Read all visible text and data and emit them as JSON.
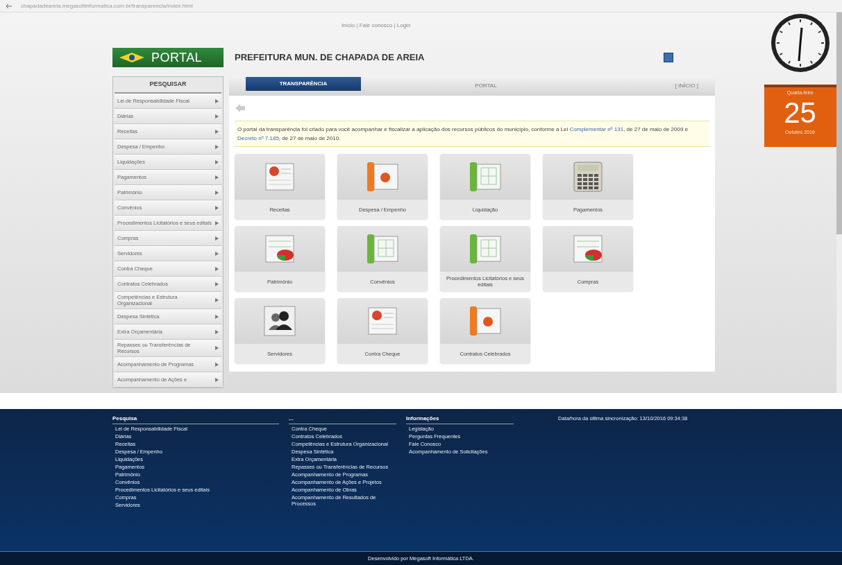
{
  "browser": {
    "url": "chapadadeareia.megasoftinformatica.com.br/transparencia/index.html"
  },
  "top_links": "Início | Fale conosco | Login",
  "header": {
    "logo_text": "PORTAL",
    "title": "PREFEITURA MUN. DE CHAPADA DE AREIA"
  },
  "sidebar": {
    "heading": "PESQUISAR",
    "items": [
      "Lei de Responsabilidade Fiscal",
      "Diárias",
      "Receitas",
      "Despesa / Empenho",
      "Liquidações",
      "Pagamentos",
      "Patrimônio",
      "Convênios",
      "Procedimentos Licitatórios e seus editais",
      "Compras",
      "Servidores",
      "Contra Cheque",
      "Contratos Celebrados",
      "Competências e Estrutura Organizacional",
      "Despesa Sintética",
      "Extra Orçamentária",
      "Repasses ou Transferências de Recursos",
      "Acompanhamento de Programas",
      "Acompanhamento de Ações e"
    ]
  },
  "tabs": [
    {
      "label": "TRANSPARÊNCIA",
      "selected": true
    },
    {
      "label": "PORTAL",
      "selected": false
    }
  ],
  "tab_bar_link": "[ INÍCIO ]",
  "notice": [
    {
      "kind": "text",
      "text": "O portal da transparência foi criado para você acompanhar e fiscalizar a aplicação dos recursos públicos do município, conforme a Lei "
    },
    {
      "kind": "link",
      "text": "Complementar nº 131"
    },
    {
      "kind": "text",
      "text": ", de 27 de maio de 2009 e "
    },
    {
      "kind": "link",
      "text": "Decreto nº 7.185"
    },
    {
      "kind": "text",
      "text": ", de 27 de maio de 2010."
    }
  ],
  "tiles": [
    {
      "label": "Receitas",
      "kind": "report"
    },
    {
      "label": "Despesa / Empenho",
      "kind": "binder"
    },
    {
      "label": "Liquidação",
      "kind": "folder"
    },
    {
      "label": "Pagamentos",
      "kind": "calculator"
    },
    {
      "label": "Patrimônio",
      "kind": "piechart"
    },
    {
      "label": "Convênios",
      "kind": "folder"
    },
    {
      "label": "Procedimentos Licitatórios e seus editais",
      "kind": "folder"
    },
    {
      "label": "Compras",
      "kind": "piechart"
    },
    {
      "label": "Servidores",
      "kind": "people"
    },
    {
      "label": "Contra Cheque",
      "kind": "report"
    },
    {
      "label": "Contratos Celebrados",
      "kind": "binder"
    }
  ],
  "calendar": {
    "weekday": "Quarta-feira",
    "day": "25",
    "month": "Outubro 2016"
  },
  "footer": {
    "columns": [
      {
        "heading": "Pesquisa",
        "items": [
          "Lei de Responsabilidade Fiscal",
          "Diárias",
          "Receitas",
          "Despesa / Empenho",
          "Liquidações",
          "Pagamentos",
          "Patrimônio",
          "Convênios",
          "Procedimentos Licitatórios e seus editais",
          "Compras",
          "Servidores"
        ]
      },
      {
        "heading": "...",
        "items": [
          "Contra Cheque",
          "Contratos Celebrados",
          "Competências e Estrutura Organizacional",
          "Despesa Sintética",
          "Extra Orçamentária",
          "Repasses ou Transferências de Recursos",
          "Acompanhamento de Programas",
          "Acompanhamento de Ações e Projetos",
          "Acompanhamento de Obras",
          "Acompanhamento de Resultados de Processos"
        ]
      },
      {
        "heading": "Informações",
        "items": [
          "Legislação",
          "Perguntas Frequentes",
          "Fale Conosco",
          "Acompanhamento de Solicitações"
        ]
      }
    ],
    "update_note": "Data/hora da última sincronização: 13/10/2016 09:34:38",
    "credit": "Desenvolvido por Megasoft Informática LTDA."
  }
}
